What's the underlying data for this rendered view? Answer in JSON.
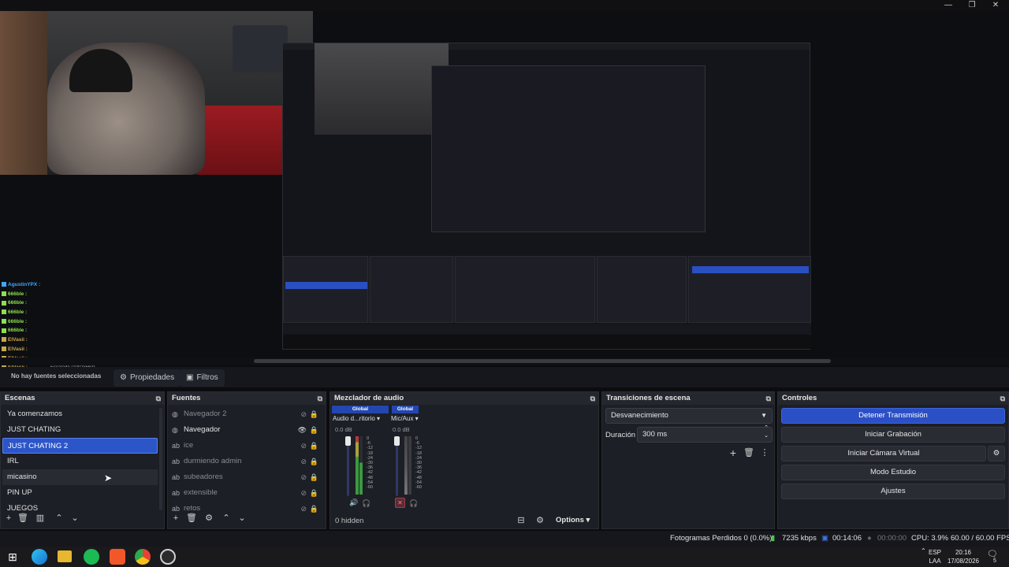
{
  "window": {
    "minimize": "—",
    "restore": "❐",
    "close": "✕"
  },
  "preview": {
    "chat": [
      {
        "user": "AgustinYPX :",
        "color": "#3fa8ff"
      },
      {
        "user": "666ble :",
        "color": "#8be04e"
      },
      {
        "user": "666ble :",
        "color": "#8be04e"
      },
      {
        "user": "666ble :",
        "color": "#8be04e"
      },
      {
        "user": "666ble :",
        "color": "#8be04e"
      },
      {
        "user": "666ble :",
        "color": "#8be04e"
      },
      {
        "user": "ElVasii :",
        "color": "#c8a84e"
      },
      {
        "user": "ElVasii :",
        "color": "#c8a84e"
      },
      {
        "user": "ElVasii :",
        "color": "#c8a84e"
      },
      {
        "user": "ElVasii :",
        "color": "#c8a84e"
      }
    ],
    "scale_label": "Escalado (1002x563)"
  },
  "context_bar": {
    "source_label": "No hay fuentes seleccionadas",
    "properties_label": "Propiedades",
    "filters_label": "Filtros"
  },
  "scenes": {
    "title": "Escenas",
    "items": [
      "Ya comenzamos",
      "JUST CHATING",
      "JUST CHATING 2",
      "IRL",
      "micasino",
      "PIN UP",
      "JUEGOS"
    ],
    "selected_index": 2
  },
  "sources": {
    "title": "Fuentes",
    "items": [
      {
        "name": "Navegador 2",
        "icon": "globe-icon",
        "visible": false
      },
      {
        "name": "Navegador",
        "icon": "globe-icon",
        "visible": true
      },
      {
        "name": "ice",
        "icon": "text-icon",
        "visible": false
      },
      {
        "name": "durmiendo admin",
        "icon": "text-icon",
        "visible": false
      },
      {
        "name": "subeadores",
        "icon": "text-icon",
        "visible": false
      },
      {
        "name": "extensible",
        "icon": "text-icon",
        "visible": false
      },
      {
        "name": "retos",
        "icon": "text-icon",
        "visible": false
      }
    ]
  },
  "mixer": {
    "title": "Mezclador de audio",
    "channels": [
      {
        "global": "Global",
        "name": "Audio d...ritorio",
        "db": "0.0 dB",
        "muted": false
      },
      {
        "global": "Global",
        "name": "Mic/Aux",
        "db": "0.0 dB",
        "muted": true
      }
    ],
    "scale": [
      "0",
      "-6",
      "-12",
      "-18",
      "-24",
      "-30",
      "-36",
      "-42",
      "-48",
      "-54",
      "-60"
    ],
    "hidden_label": "0 hidden",
    "options_label": "Options"
  },
  "transitions": {
    "title": "Transiciones de escena",
    "selected": "Desvanecimiento",
    "duration_label": "Duración",
    "duration_value": "300 ms"
  },
  "controls": {
    "title": "Controles",
    "buttons": [
      "Detener Transmisión",
      "Iniciar Grabación",
      "Iniciar Cámara Virtual",
      "Modo Estudio",
      "Ajustes"
    ]
  },
  "status": {
    "dropped": "Fotogramas Perdidos 0 (0.0%)",
    "bitrate": "7235 kbps",
    "stream_time": "00:14:06",
    "rec_time": "00:00:00",
    "cpu": "CPU: 3.9%",
    "fps": "60.00 / 60.00 FPS"
  },
  "taskbar": {
    "lang_top": "ESP",
    "lang_bottom": "LAA",
    "time": "20:16",
    "date": "17/08/2026",
    "notif_count": "5"
  },
  "colors": {
    "accent": "#2b4fc4",
    "panel": "#1d1f26"
  }
}
